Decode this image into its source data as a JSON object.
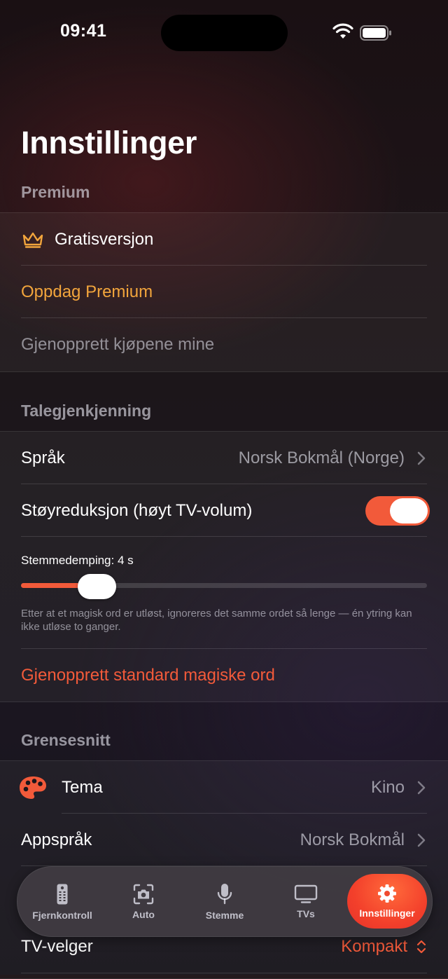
{
  "status_bar": {
    "time": "09:41"
  },
  "page_title": "Innstillinger",
  "colors": {
    "accent": "#f25a3a",
    "premium": "#f2a53c",
    "background": "#1b1519"
  },
  "sections": {
    "premium": {
      "header": "Premium",
      "plan_label": "Gratisversjon",
      "plan_icon": "crown-icon",
      "discover_label": "Oppdag Premium",
      "restore_label": "Gjenopprett kjøpene mine"
    },
    "speech": {
      "header": "Talegjenkjenning",
      "language_label": "Språk",
      "language_value": "Norsk Bokmål (Norge)",
      "noise_label": "Støyreduksjon (høyt TV-volum)",
      "noise_enabled": true,
      "cooldown_label": "Stemmedemping: 4 s",
      "cooldown_level": 0.14,
      "cooldown_help": "Etter at et magisk ord er utløst, ignoreres det samme ordet så lenge — én ytring kan ikke utløse to ganger.",
      "restore_words_label": "Gjenopprett standard magiske ord"
    },
    "interface": {
      "header": "Grensesnitt",
      "theme_label": "Tema",
      "theme_icon": "palette-icon",
      "theme_value": "Kino",
      "app_language_label": "Appspråk",
      "app_language_value": "Norsk Bokmål",
      "tv_picker_label": "TV-velger",
      "tv_picker_value": "Kompakt"
    }
  },
  "tab_bar": {
    "tabs": [
      {
        "label": "Fjernkontroll",
        "icon": "remote-icon",
        "active": false
      },
      {
        "label": "Auto",
        "icon": "camera-scan-icon",
        "active": false
      },
      {
        "label": "Stemme",
        "icon": "microphone-icon",
        "active": false
      },
      {
        "label": "TVs",
        "icon": "tv-icon",
        "active": false
      },
      {
        "label": "Innstillinger",
        "icon": "gear-icon",
        "active": true
      }
    ]
  }
}
